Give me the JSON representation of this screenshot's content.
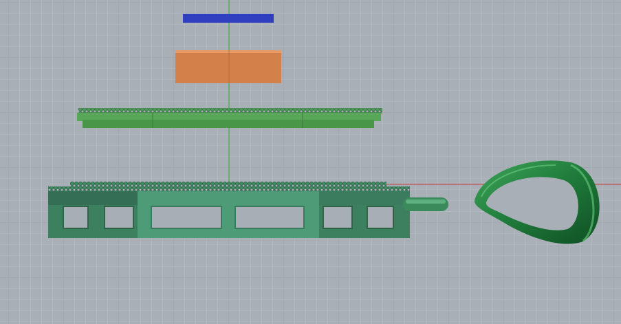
{
  "viewport": {
    "background_color": "#a9afb7",
    "axis_colors": {
      "vertical_axis": "#3fae4a",
      "horizontal_axis": "#c0504d"
    },
    "objects": [
      {
        "name": "blue-bar",
        "color": "#2f3fbf"
      },
      {
        "name": "orange-block",
        "color": "#d4804a"
      },
      {
        "name": "green-top-plate",
        "color": "#4e9a4c"
      },
      {
        "name": "green-base-frame",
        "color": "#3d8a67"
      },
      {
        "name": "green-pin",
        "color": "#3e8a5c"
      },
      {
        "name": "green-loop-ring",
        "color": "#2f8a45"
      }
    ]
  }
}
